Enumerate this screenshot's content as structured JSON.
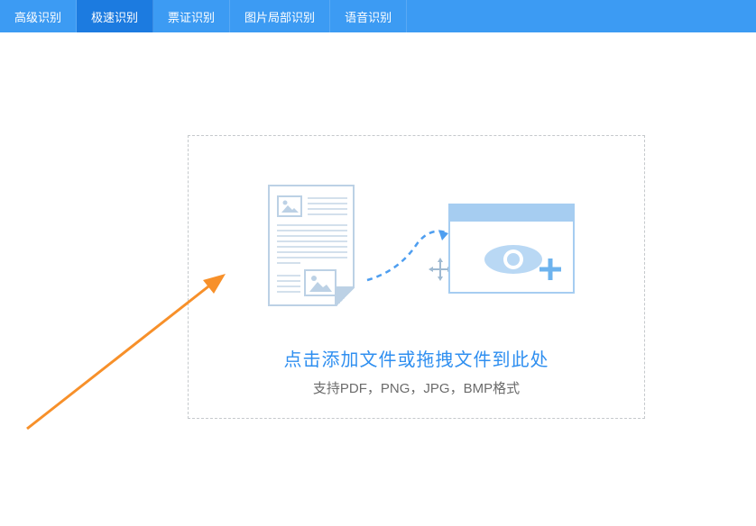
{
  "nav": {
    "tabs": [
      {
        "label": "高级识别",
        "active": false
      },
      {
        "label": "极速识别",
        "active": true
      },
      {
        "label": "票证识别",
        "active": false
      },
      {
        "label": "图片局部识别",
        "active": false
      },
      {
        "label": "语音识别",
        "active": false
      }
    ]
  },
  "dropzone": {
    "title": "点击添加文件或拖拽文件到此处",
    "subtitle": "支持PDF，PNG，JPG，BMP格式"
  },
  "accent_color": "#3c9bf3",
  "active_color": "#1c7be0"
}
